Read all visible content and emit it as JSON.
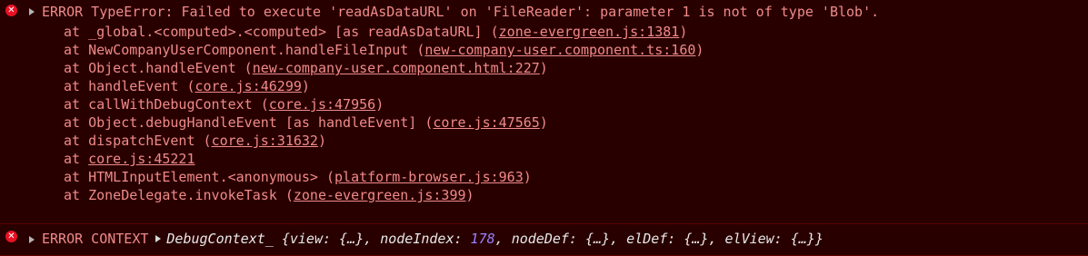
{
  "error": {
    "message": "ERROR TypeError: Failed to execute 'readAsDataURL' on 'FileReader': parameter 1 is not of type 'Blob'.",
    "frames": [
      {
        "text": "at _global.<computed>.<computed> [as readAsDataURL] (",
        "link": "zone-evergreen.js:1381",
        "suffix": ")"
      },
      {
        "text": "at NewCompanyUserComponent.handleFileInput (",
        "link": "new-company-user.component.ts:160",
        "suffix": ")"
      },
      {
        "text": "at Object.handleEvent (",
        "link": "new-company-user.component.html:227",
        "suffix": ")"
      },
      {
        "text": "at handleEvent (",
        "link": "core.js:46299",
        "suffix": ")"
      },
      {
        "text": "at callWithDebugContext (",
        "link": "core.js:47956",
        "suffix": ")"
      },
      {
        "text": "at Object.debugHandleEvent [as handleEvent] (",
        "link": "core.js:47565",
        "suffix": ")"
      },
      {
        "text": "at dispatchEvent (",
        "link": "core.js:31632",
        "suffix": ")"
      },
      {
        "text": "at ",
        "link": "core.js:45221",
        "suffix": ""
      },
      {
        "text": "at HTMLInputElement.<anonymous> (",
        "link": "platform-browser.js:963",
        "suffix": ")"
      },
      {
        "text": "at ZoneDelegate.invokeTask (",
        "link": "zone-evergreen.js:399",
        "suffix": ")"
      }
    ]
  },
  "context": {
    "label": "ERROR CONTEXT",
    "object_prefix": "DebugContext_ {view: {…}, nodeIndex: ",
    "node_index": "178",
    "object_suffix": ", nodeDef: {…}, elDef: {…}, elView: {…}}"
  },
  "icons": {
    "error": "error-circle-icon",
    "expand": "expand-triangle-icon"
  },
  "colors": {
    "background": "#290000",
    "text": "#f08a8a",
    "icon": "#e81123",
    "number": "#9980ff"
  }
}
